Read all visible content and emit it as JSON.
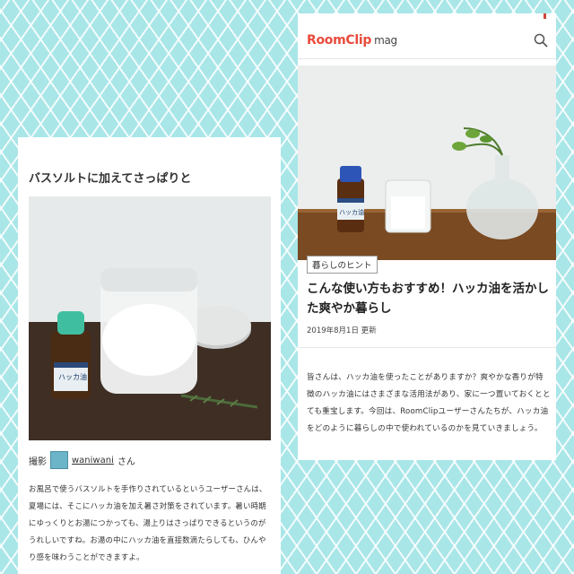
{
  "left": {
    "title": "バスソルトに加えてさっぱりと",
    "credit_prefix": "撮影",
    "credit_user": "waniwani",
    "credit_suffix": "さん",
    "photo_bottle_label": "ハッカ油",
    "body": "お風呂で使うバスソルトを手作りされているというユーザーさんは、夏場には、そこにハッカ油を加え暑さ対策をされています。暑い時期にゆっくりとお湯につかっても、湯上りはさっぱりできるというのがうれしいですね。お湯の中にハッカ油を直接数滴たらしても、ひんやり感を味わうことができますよ。"
  },
  "right": {
    "logo_main": "RoomClip",
    "logo_sub": "mag",
    "hero_bottle_label": "ハッカ油",
    "tag": "暮らしのヒント",
    "title": "こんな使い方もおすすめ！ハッカ油を活かした爽やか暮らし",
    "date": "2019年8月1日 更新",
    "body": "皆さんは、ハッカ油を使ったことがありますか？爽やかな香りが特徴のハッカ油にはさまざまな活用法があり、家に一つ置いておくととても重宝します。今回は、RoomClipユーザーさんたちが、ハッカ油をどのように暮らしの中で使われているのかを見ていきましょう。"
  },
  "colors": {
    "background": "#a9e6e8",
    "brand": "#e94b3c"
  }
}
